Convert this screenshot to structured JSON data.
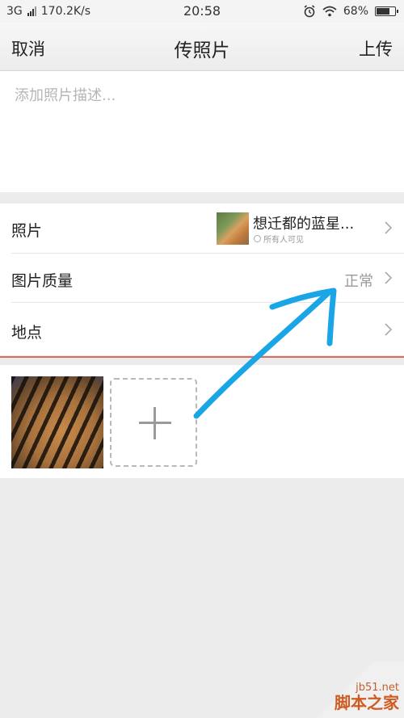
{
  "status_bar": {
    "network": "3G",
    "speed": "170.2K/s",
    "time": "20:58",
    "battery": "68%"
  },
  "header": {
    "cancel_label": "取消",
    "title": "传照片",
    "upload_label": "上传"
  },
  "description": {
    "placeholder": "添加照片描述..."
  },
  "settings": {
    "album_label": "照片",
    "album_name": "想迁都的蓝星...",
    "album_visibility": "所有人可见",
    "quality_label": "图片质量",
    "quality_value": "正常",
    "location_label": "地点"
  },
  "colors": {
    "annotation_arrow": "#1aa6e6",
    "divider_red": "#e06a5a",
    "background": "#ececec"
  },
  "watermark": {
    "site": "jb51.net",
    "name": "脚本之家"
  }
}
